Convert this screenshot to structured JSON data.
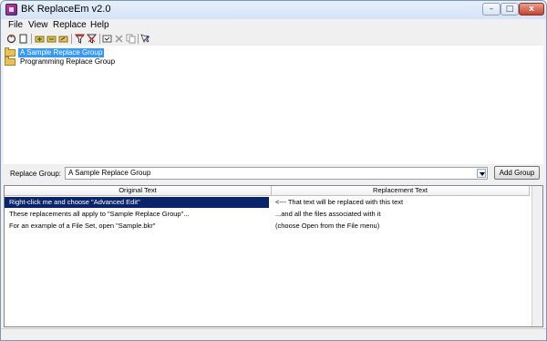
{
  "window": {
    "title": "BK ReplaceEm v2.0",
    "icon": "app-icon",
    "buttons": {
      "minimize": "–",
      "maximize": "□",
      "close": "x"
    }
  },
  "menu": {
    "items": [
      {
        "label": "File"
      },
      {
        "label": "View"
      },
      {
        "label": "Replace"
      },
      {
        "label": "Help"
      }
    ]
  },
  "toolbar": {
    "icons": [
      "open-icon",
      "new-icon",
      "add-folder-icon",
      "remove-folder-icon",
      "edit-folder-icon",
      "filter-icon",
      "filter-remove-icon",
      "check-icon",
      "delete-icon",
      "copy-icon",
      "help-icon"
    ]
  },
  "tree": {
    "items": [
      {
        "label": "A Sample Replace Group",
        "selected": true
      },
      {
        "label": "Programming Replace Group",
        "selected": false
      }
    ]
  },
  "replace_group": {
    "label": "Replace Group:",
    "value": "A Sample Replace Group",
    "add_button": "Add Group"
  },
  "grid": {
    "columns": [
      "Original Text",
      "Replacement Text"
    ],
    "rows": [
      {
        "original": "Right-click me and choose \"Advanced Edit\"",
        "replacement": "<--- That text will be replaced with this text",
        "selected": true
      },
      {
        "original": "These replacements all apply to \"Sample Replace Group\"...",
        "replacement": "...and all the files associated with it",
        "selected": false
      },
      {
        "original": "For an example of a File Set, open \"Sample.bkr\"",
        "replacement": "(choose Open from the File menu)",
        "selected": false
      }
    ]
  },
  "colors": {
    "selection": "#0a246a",
    "tree_selection": "#3399ff",
    "titlebar": "#d4e3f5"
  }
}
